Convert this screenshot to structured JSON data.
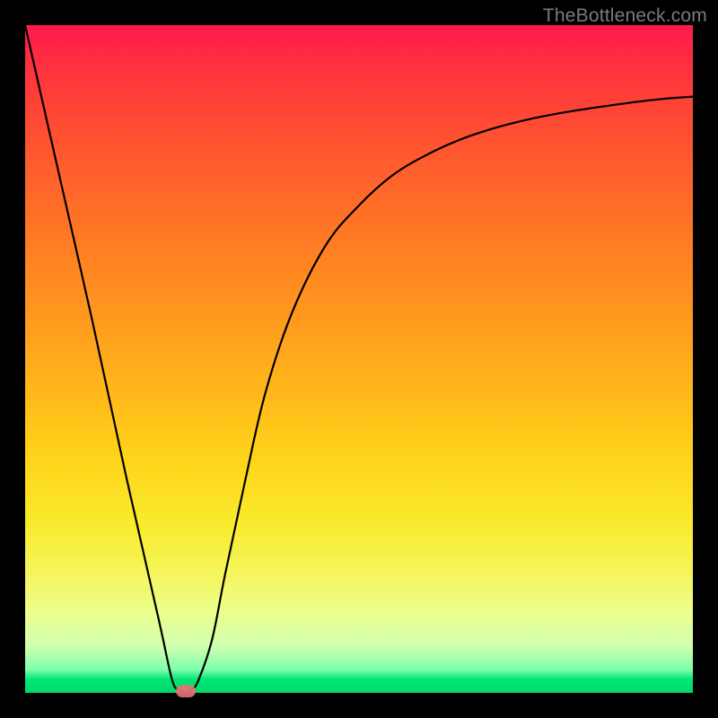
{
  "watermark": "TheBottleneck.com",
  "chart_data": {
    "type": "line",
    "title": "",
    "xlabel": "",
    "ylabel": "",
    "xlim": [
      0,
      100
    ],
    "ylim": [
      0,
      100
    ],
    "x": [
      0,
      5,
      10,
      15,
      20,
      22,
      23,
      24,
      25,
      26,
      28,
      30,
      33,
      36,
      40,
      45,
      50,
      55,
      60,
      65,
      70,
      75,
      80,
      85,
      90,
      95,
      100
    ],
    "y": [
      100,
      78,
      56,
      33,
      11,
      2,
      0.5,
      0,
      0.5,
      2,
      8,
      18,
      32,
      45,
      57,
      67,
      73,
      77.5,
      80.5,
      82.8,
      84.5,
      85.8,
      86.8,
      87.6,
      88.3,
      88.9,
      89.3
    ],
    "marker_x": 24,
    "marker_y": 0
  }
}
